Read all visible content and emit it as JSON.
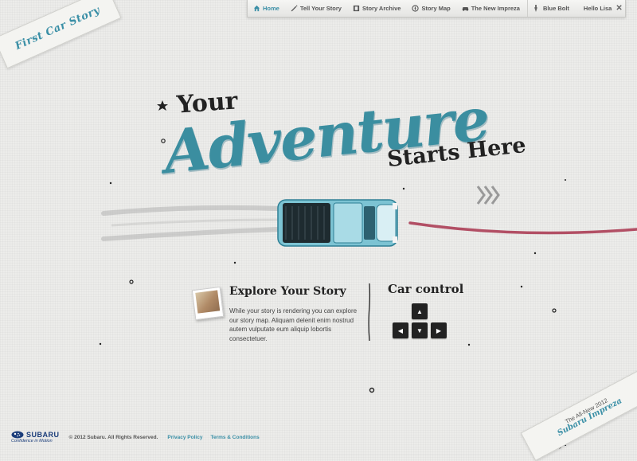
{
  "nav": {
    "items": [
      {
        "label": "Home",
        "icon": "home-icon",
        "active": true
      },
      {
        "label": "Tell Your Story",
        "icon": "pencil-icon"
      },
      {
        "label": "Story Archive",
        "icon": "film-icon"
      },
      {
        "label": "Story Map",
        "icon": "compass-icon"
      },
      {
        "label": "The New Impreza",
        "icon": "car-icon"
      }
    ],
    "user_car": "Blue Bolt",
    "greeting": "Hello Lisa",
    "close": "✕"
  },
  "logo": {
    "text": "First Car Story"
  },
  "headline": {
    "line1": "Your",
    "line2": "Adventure",
    "line3": "Starts Here"
  },
  "story": {
    "title": "Explore Your Story",
    "body": "While your story is rendering you can explore our story map. Aliquam delenit enim nostrud autem vulputate eum aliquip lobortis consectetuer."
  },
  "car_control": {
    "title": "Car control",
    "keys": {
      "up": "▲",
      "left": "◀",
      "down": "▼",
      "right": "▶"
    }
  },
  "promo": {
    "line1": "The All-New 2012",
    "line2": "Subaru Impreza"
  },
  "footer": {
    "brand": "SUBARU",
    "tagline": "Confidence in Motion",
    "copyright": "© 2012 Subaru. All Rights Reserved.",
    "privacy": "Privacy Policy",
    "terms": "Terms & Conditions"
  },
  "colors": {
    "accent": "#3a8fa6",
    "headline_teal": "#3b8ea0",
    "road_stripe": "#a8344e"
  }
}
